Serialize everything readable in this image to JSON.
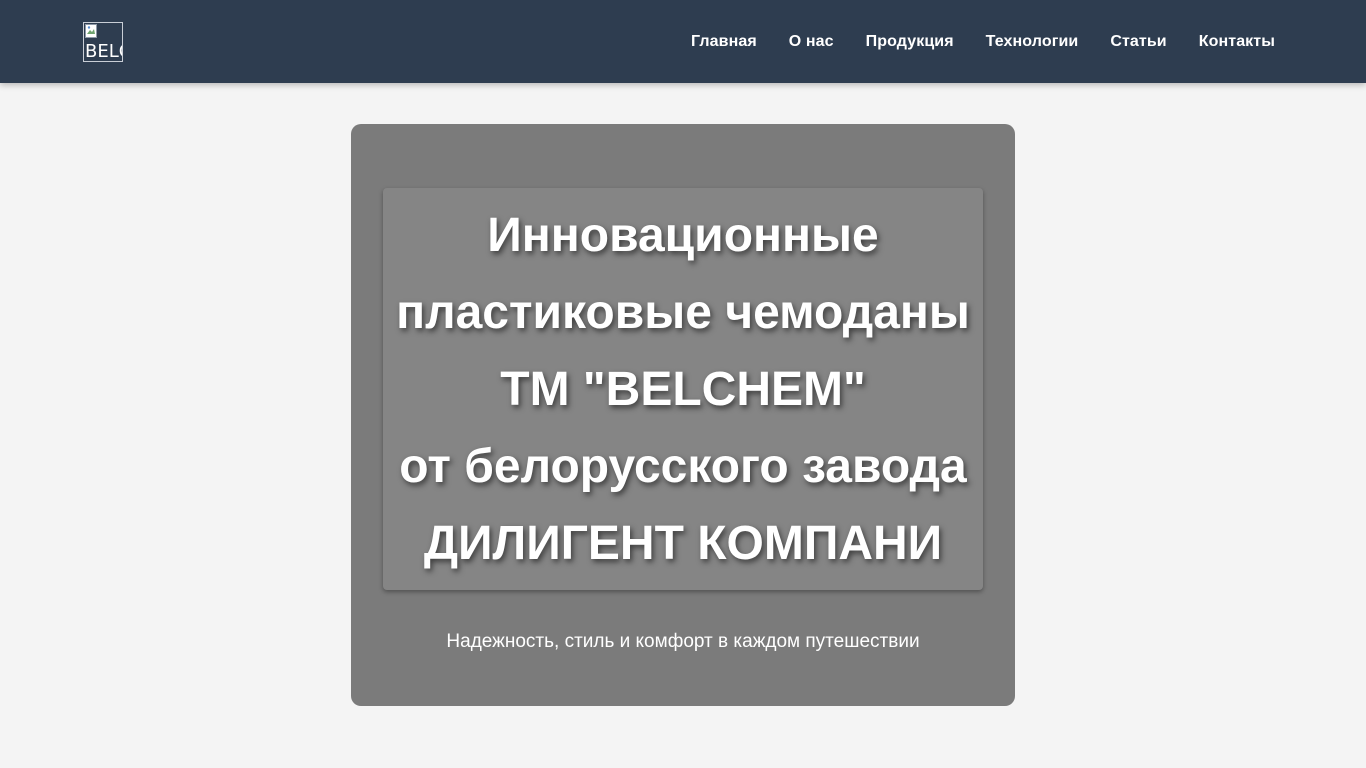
{
  "header": {
    "logo_alt": "BELCHEM",
    "nav": [
      {
        "label": "Главная"
      },
      {
        "label": "О нас"
      },
      {
        "label": "Продукция"
      },
      {
        "label": "Технологии"
      },
      {
        "label": "Статьи"
      },
      {
        "label": "Контакты"
      }
    ]
  },
  "hero": {
    "title_lines": [
      "Инновационные",
      "пластиковые чемоданы",
      "ТМ \"BELCHEM\"",
      "от белорусского завода",
      "ДИЛИГЕНТ КОМПАНИ"
    ],
    "subtitle": "Надежность, стиль и комфорт в каждом путешествии"
  },
  "colors": {
    "header_bg": "#2e3d50",
    "page_bg": "#f4f4f4",
    "hero_bg": "#7b7b7b",
    "title_box_bg": "#858585",
    "text": "#ffffff"
  }
}
